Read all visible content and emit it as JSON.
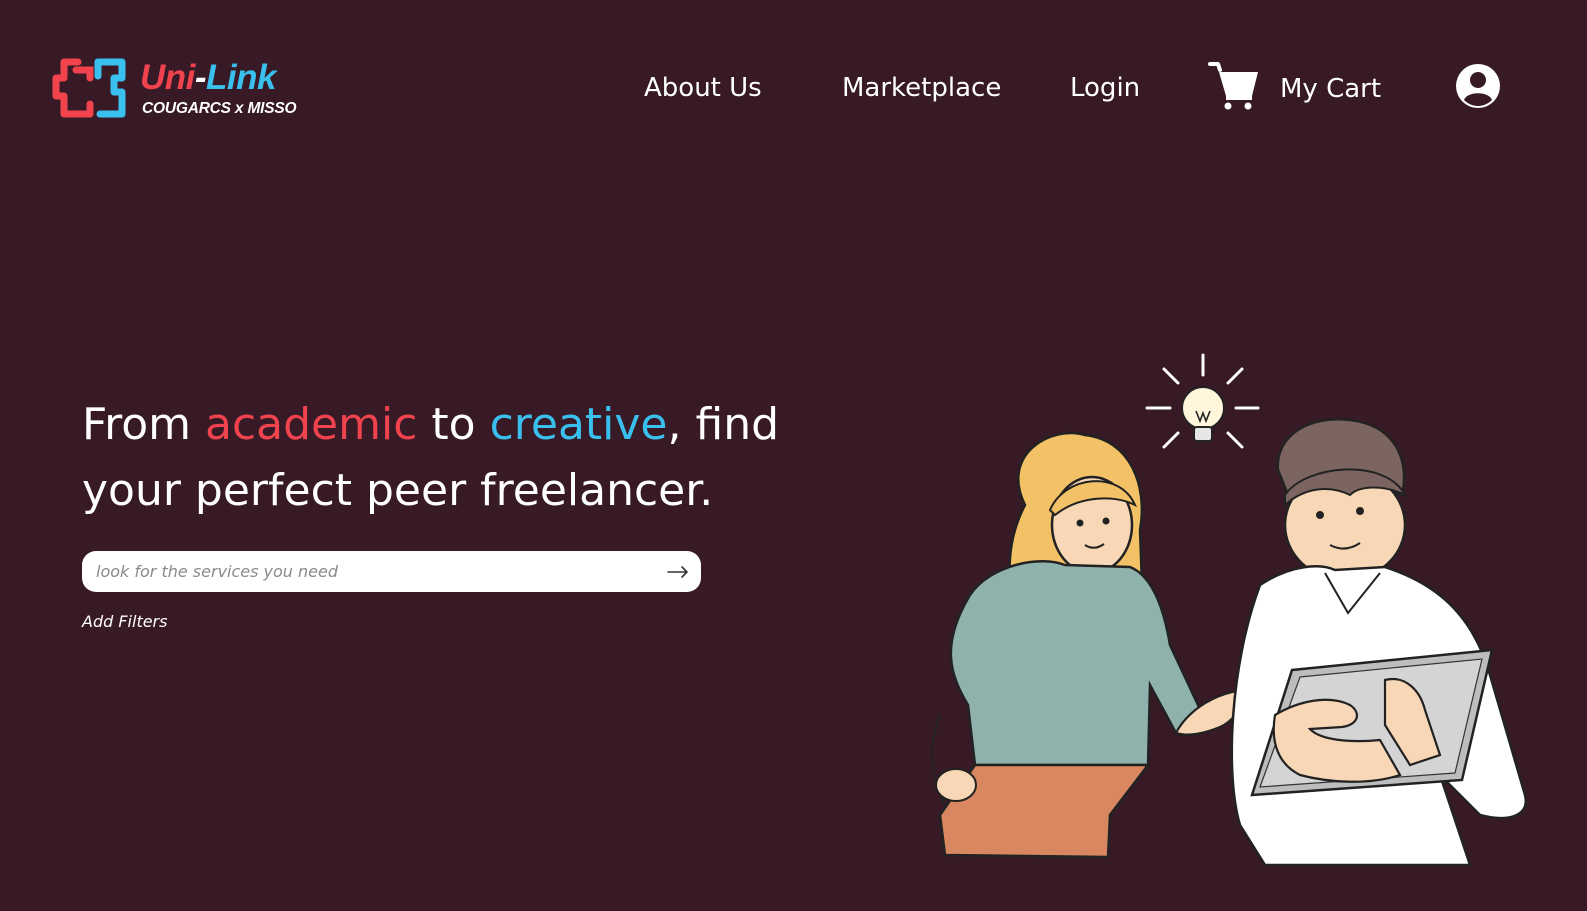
{
  "brand": {
    "name_part1": "Uni",
    "name_dash": "-",
    "name_part2": "Link",
    "tagline": "COUGARCS x MISSO",
    "colors": {
      "red": "#f0434e",
      "blue": "#39c0ee"
    }
  },
  "nav": {
    "about": "About Us",
    "marketplace": "Marketplace",
    "login": "Login",
    "cart": "My Cart",
    "cart_icon": "cart-icon",
    "account_icon": "user-circle-icon"
  },
  "hero": {
    "line1_a": "From ",
    "line1_red": "academic",
    "line1_b": " to ",
    "line1_blue": "creative",
    "line1_c": ", find",
    "line2": "your perfect peer freelancer."
  },
  "search": {
    "placeholder": "look for the services you need",
    "value": "",
    "submit_icon": "arrow-right-icon"
  },
  "filters": {
    "label": "Add Filters"
  },
  "theme": {
    "background": "#371a26",
    "text": "#ffffff"
  }
}
